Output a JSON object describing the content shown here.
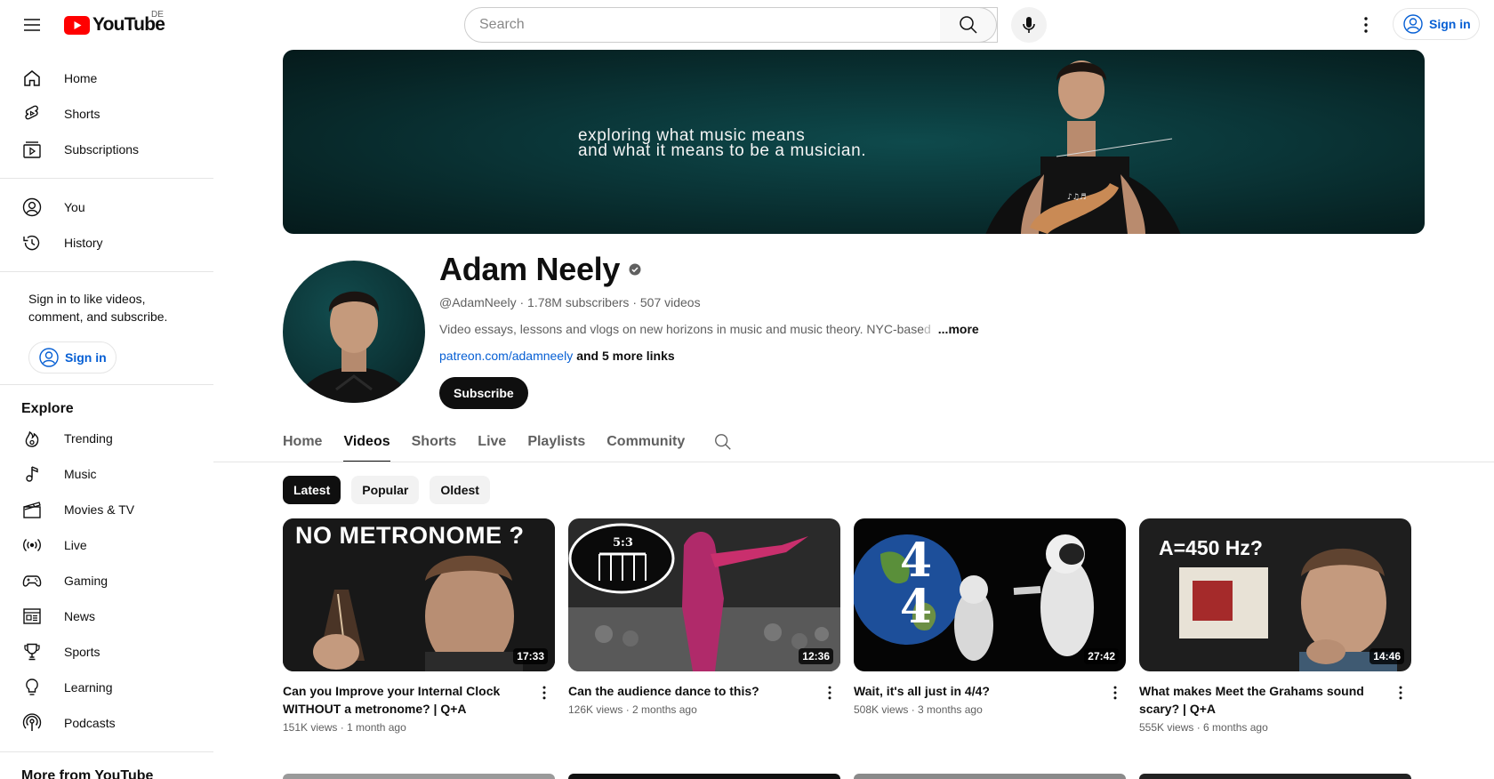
{
  "header": {
    "logo_text": "YouTube",
    "country_code": "DE",
    "search_placeholder": "Search",
    "sign_in_label": "Sign in"
  },
  "sidebar": {
    "main_items": [
      {
        "label": "Home",
        "icon": "home-icon"
      },
      {
        "label": "Shorts",
        "icon": "shorts-icon"
      },
      {
        "label": "Subscriptions",
        "icon": "subscriptions-icon"
      }
    ],
    "you_items": [
      {
        "label": "You",
        "icon": "account-icon"
      },
      {
        "label": "History",
        "icon": "history-icon"
      }
    ],
    "signin_prompt": "Sign in to like videos, comment, and subscribe.",
    "signin_label": "Sign in",
    "explore_heading": "Explore",
    "explore_items": [
      {
        "label": "Trending",
        "icon": "trending-icon"
      },
      {
        "label": "Music",
        "icon": "music-icon"
      },
      {
        "label": "Movies & TV",
        "icon": "movies-icon"
      },
      {
        "label": "Live",
        "icon": "live-icon"
      },
      {
        "label": "Gaming",
        "icon": "gaming-icon"
      },
      {
        "label": "News",
        "icon": "news-icon"
      },
      {
        "label": "Sports",
        "icon": "sports-icon"
      },
      {
        "label": "Learning",
        "icon": "learning-icon"
      },
      {
        "label": "Podcasts",
        "icon": "podcasts-icon"
      }
    ],
    "more_heading": "More from YouTube"
  },
  "banner": {
    "line1": "exploring what music means",
    "line2": "and what it means to be a musician."
  },
  "channel": {
    "name": "Adam Neely",
    "handle": "@AdamNeely",
    "subscribers": "1.78M subscribers",
    "videos": "507 videos",
    "description": "Video essays, lessons and vlogs on new horizons in music and music theory. NYC-base",
    "description_fade": "d",
    "more_label": "...more",
    "link": "patreon.com/adamneely",
    "more_links": "and 5 more links",
    "subscribe_label": "Subscribe"
  },
  "tabs": [
    {
      "label": "Home",
      "active": false
    },
    {
      "label": "Videos",
      "active": true
    },
    {
      "label": "Shorts",
      "active": false
    },
    {
      "label": "Live",
      "active": false
    },
    {
      "label": "Playlists",
      "active": false
    },
    {
      "label": "Community",
      "active": false
    }
  ],
  "chips": [
    {
      "label": "Latest",
      "active": true
    },
    {
      "label": "Popular",
      "active": false
    },
    {
      "label": "Oldest",
      "active": false
    }
  ],
  "videos": [
    {
      "title": "Can you Improve your Internal Clock WITHOUT a metronome? | Q+A",
      "views": "151K views",
      "age": "1 month ago",
      "duration": "17:33",
      "thumb_text": "NO METRONOME ?"
    },
    {
      "title": "Can the audience dance to this?",
      "views": "126K views",
      "age": "2 months ago",
      "duration": "12:36",
      "thumb_text": "5:3"
    },
    {
      "title": "Wait, it's all just in 4/4?",
      "views": "508K views",
      "age": "3 months ago",
      "duration": "27:42",
      "thumb_text_top": "4",
      "thumb_text_bottom": "4"
    },
    {
      "title": "What makes Meet the Grahams sound scary? | Q+A",
      "views": "555K views",
      "age": "6 months ago",
      "duration": "14:46",
      "thumb_text": "A=450 Hz?"
    }
  ],
  "colors": {
    "accent_link": "#065fd4",
    "brand_red": "#ff0000",
    "text_primary": "#0f0f0f",
    "text_secondary": "#606060",
    "banner_bg": "#0a3436"
  }
}
